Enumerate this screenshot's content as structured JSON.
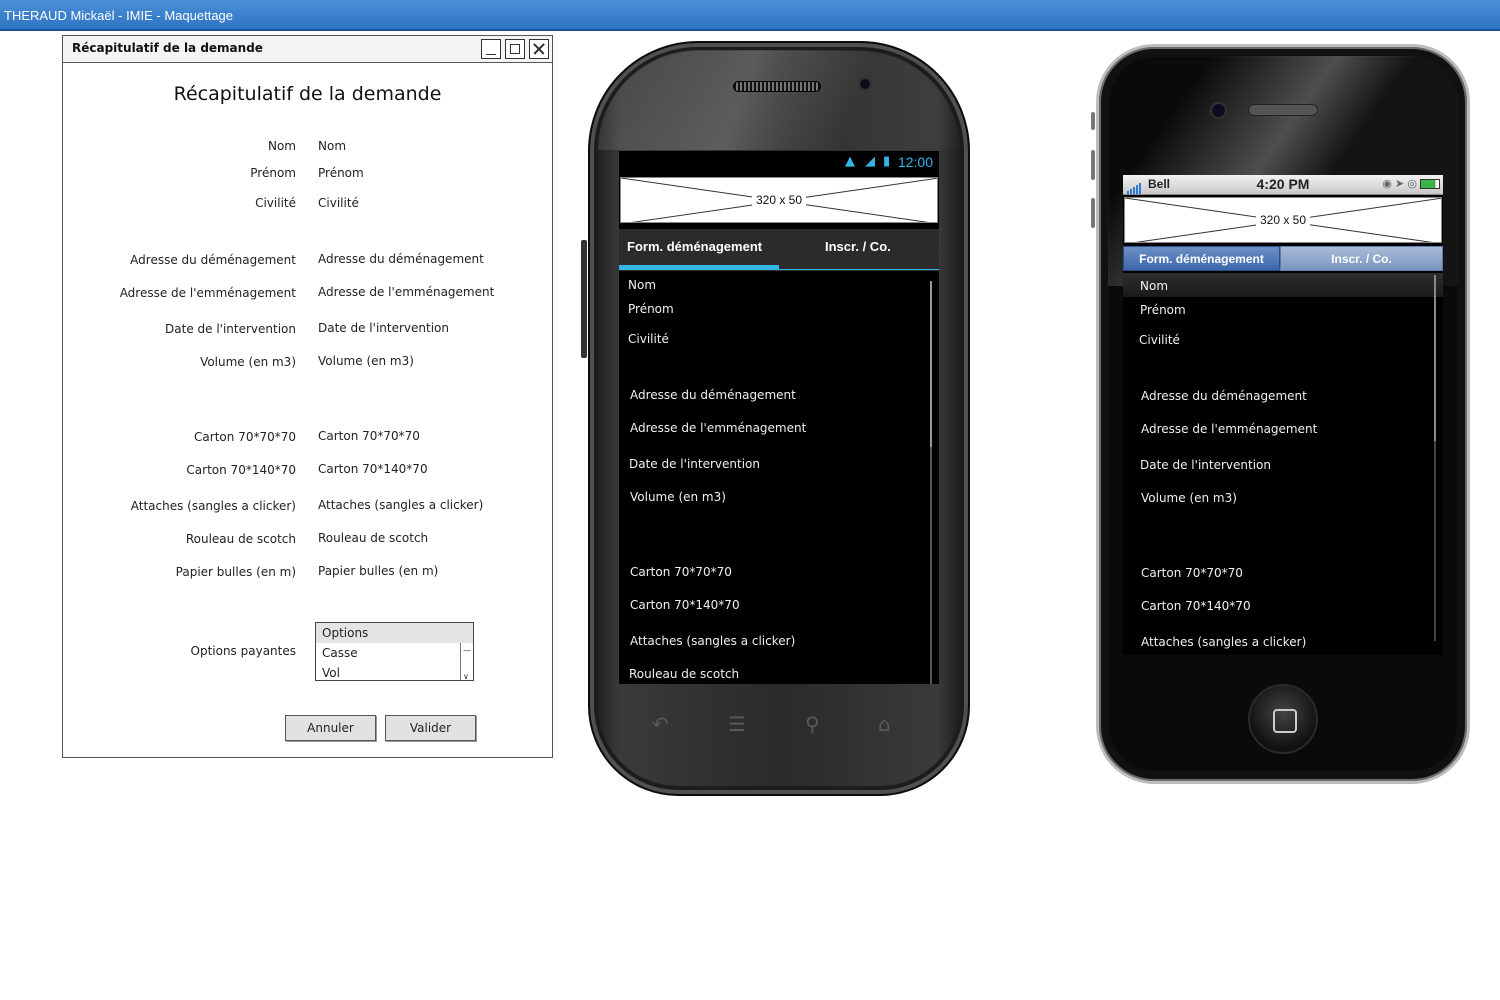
{
  "app_title": "THERAUD Mickaël - IMIE - Maquettage",
  "window": {
    "title": "Récapitulatif de la demande",
    "heading": "Récapitulatif de la demande",
    "rows": [
      {
        "label": "Nom",
        "value": "Nom"
      },
      {
        "label": "Prénom",
        "value": "Prénom"
      },
      {
        "label": "Civilité",
        "value": "Civilité"
      },
      {
        "label": "Adresse du déménagement",
        "value": "Adresse du déménagement"
      },
      {
        "label": "Adresse de l'emménagement",
        "value": "Adresse de l'emménagement"
      },
      {
        "label": "Date de l'intervention",
        "value": "Date de l'intervention"
      },
      {
        "label": "Volume (en m3)",
        "value": "Volume (en m3)"
      },
      {
        "label": "Carton 70*70*70",
        "value": "Carton 70*70*70"
      },
      {
        "label": "Carton 70*140*70",
        "value": "Carton 70*140*70"
      },
      {
        "label": "Attaches (sangles a clicker)",
        "value": "Attaches (sangles a clicker)"
      },
      {
        "label": "Rouleau de scotch",
        "value": "Rouleau de scotch"
      },
      {
        "label": "Papier bulles (en m)",
        "value": "Papier bulles (en m)"
      }
    ],
    "options_label": "Options payantes",
    "options": [
      "Options",
      "Casse",
      "Vol"
    ],
    "cancel_label": "Annuler",
    "validate_label": "Valider"
  },
  "android": {
    "status_time": "12:00",
    "banner_text": "320 x 50",
    "tab_active": "Form. déménagement",
    "tab_other": "Inscr. / Co.",
    "items": [
      "Nom",
      "Prénom",
      "Civilité",
      "Adresse du déménagement",
      "Adresse de l'emménagement",
      "Date de l'intervention",
      "Volume (en m3)",
      "Carton 70*70*70",
      "Carton 70*140*70",
      "Attaches (sangles a clicker)",
      "Rouleau de scotch"
    ]
  },
  "iphone": {
    "carrier": "Bell",
    "status_time": "4:20 PM",
    "banner_text": "320 x 50",
    "tab_active": "Form. déménagement",
    "tab_other": "Inscr. / Co.",
    "items": [
      "Nom",
      "Prénom",
      "Civilité",
      "Adresse du déménagement",
      "Adresse de l'emménagement",
      "Date de l'intervention",
      "Volume (en m3)",
      "Carton 70*70*70",
      "Carton 70*140*70",
      "Attaches (sangles a clicker)"
    ]
  },
  "colors": {
    "titlebar": "#3a7fcf",
    "android_accent": "#33b5e5",
    "iphone_tab": "#4a74b4"
  }
}
